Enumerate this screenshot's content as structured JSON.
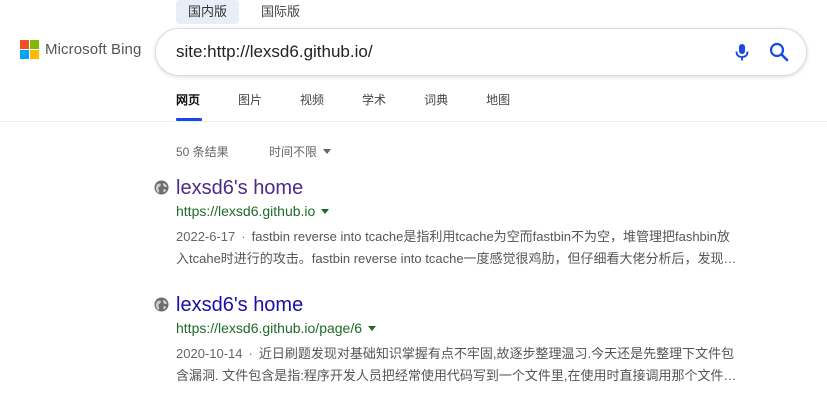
{
  "region_tabs": [
    {
      "label": "国内版",
      "active": true
    },
    {
      "label": "国际版",
      "active": false
    }
  ],
  "logo": {
    "text": "Microsoft Bing",
    "colors": [
      "#f25022",
      "#7fba00",
      "#00a4ef",
      "#ffb900"
    ]
  },
  "search": {
    "value": "site:http://lexsd6.github.io/"
  },
  "nav": {
    "items": [
      {
        "label": "网页",
        "active": true
      },
      {
        "label": "图片"
      },
      {
        "label": "视频"
      },
      {
        "label": "学术"
      },
      {
        "label": "词典"
      },
      {
        "label": "地图"
      }
    ]
  },
  "results_meta": {
    "count": "50 条结果",
    "time_filter": "时间不限"
  },
  "results": [
    {
      "title": "lexsd6's home",
      "url": "https://lexsd6.github.io",
      "date": "2022-6-17",
      "snippet_line1": "fastbin reverse into tcache是指利用tcache为空而fastbin不为空，堆管理把fashbin放",
      "snippet_line2": "入tcahe时进行的攻击。fastbin reverse into tcache一度感觉很鸡肋，但仔细看大佬分析后，发现…"
    },
    {
      "title": "lexsd6's home",
      "url": "https://lexsd6.github.io/page/6",
      "date": "2020-10-14",
      "snippet_line1": "近日刷题发现对基础知识掌握有点不牢固,故逐步整理温习.今天还是先整理下文件包",
      "snippet_line2": "含漏洞. 文件包含是指:程序开发人员把经常使用代码写到一个文件里,在使用时直接调用那个文件…"
    }
  ],
  "colors": {
    "accent": "#174ae4",
    "url_green": "#1e6b28",
    "visited_title": "#4a2c8a",
    "title": "#1a0dab"
  }
}
